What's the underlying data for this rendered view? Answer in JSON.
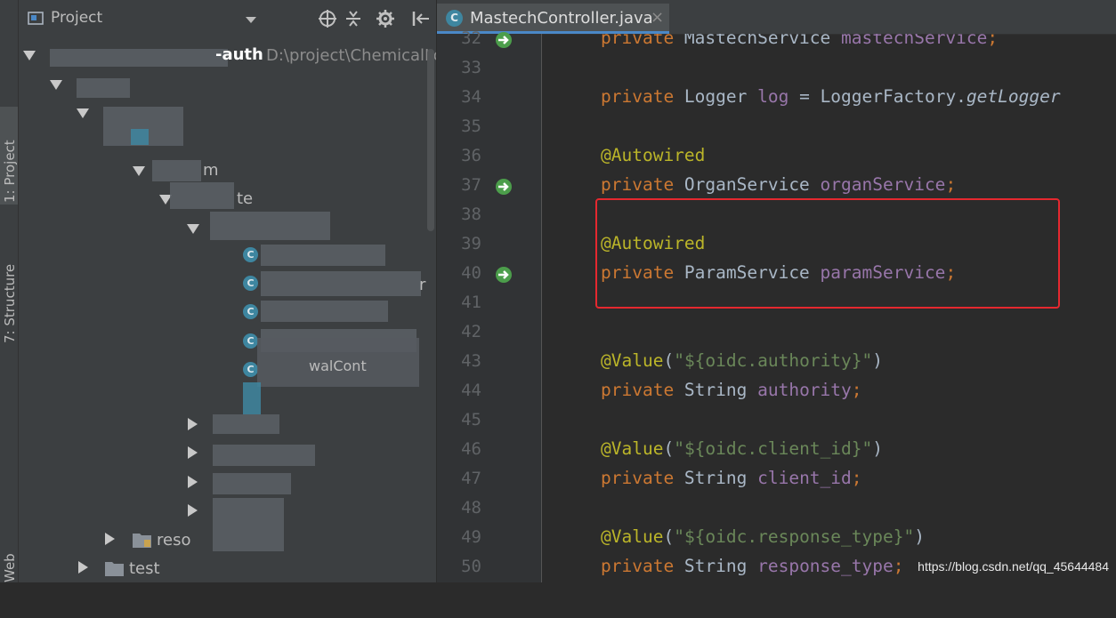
{
  "sidebar": {
    "tabs": [
      {
        "label": "1: Project"
      },
      {
        "label": "7: Structure"
      },
      {
        "label": "Web"
      }
    ]
  },
  "project_panel": {
    "title": "Project",
    "root_row": {
      "name_suffix": "-auth",
      "path": "D:\\project\\ChemicalLo"
    },
    "rows": [
      {
        "text": "m"
      },
      {
        "text": "te"
      },
      {
        "text": "r"
      },
      {
        "text": "walCont"
      },
      {
        "text": "reso"
      },
      {
        "text": "test"
      }
    ],
    "icons": [
      "target-icon",
      "collapse-icon",
      "gear-icon",
      "hide-icon"
    ]
  },
  "editor": {
    "tab": {
      "label": "MastechController.java",
      "icon_letter": "C",
      "close": "×"
    },
    "lines": [
      {
        "num": "32",
        "parts": [
          {
            "t": "private ",
            "c": "kw"
          },
          {
            "t": "MastechService ",
            "c": ""
          },
          {
            "t": "mastechService",
            "c": "fld"
          },
          {
            "t": ";",
            "c": "kw"
          }
        ]
      },
      {
        "num": "33",
        "parts": []
      },
      {
        "num": "34",
        "parts": [
          {
            "t": "private ",
            "c": "kw"
          },
          {
            "t": "Logger ",
            "c": ""
          },
          {
            "t": "log",
            "c": "fld"
          },
          {
            "t": " = LoggerFactory.",
            "c": ""
          },
          {
            "t": "getLogger",
            "c": "itl"
          }
        ]
      },
      {
        "num": "35",
        "parts": []
      },
      {
        "num": "36",
        "parts": [
          {
            "t": "@Autowired",
            "c": "ann"
          }
        ]
      },
      {
        "num": "37",
        "parts": [
          {
            "t": "private ",
            "c": "kw"
          },
          {
            "t": "OrganService ",
            "c": ""
          },
          {
            "t": "organService",
            "c": "fld"
          },
          {
            "t": ";",
            "c": "kw"
          }
        ]
      },
      {
        "num": "38",
        "parts": []
      },
      {
        "num": "39",
        "parts": [
          {
            "t": "@Autowired",
            "c": "ann"
          }
        ]
      },
      {
        "num": "40",
        "parts": [
          {
            "t": "private ",
            "c": "kw"
          },
          {
            "t": "ParamService ",
            "c": ""
          },
          {
            "t": "paramService",
            "c": "fld"
          },
          {
            "t": ";",
            "c": "kw"
          }
        ]
      },
      {
        "num": "41",
        "parts": []
      },
      {
        "num": "42",
        "parts": []
      },
      {
        "num": "43",
        "parts": [
          {
            "t": "@Value",
            "c": "ann"
          },
          {
            "t": "(",
            "c": ""
          },
          {
            "t": "\"${oidc.authority}\"",
            "c": "str"
          },
          {
            "t": ")",
            "c": ""
          }
        ]
      },
      {
        "num": "44",
        "parts": [
          {
            "t": "private ",
            "c": "kw"
          },
          {
            "t": "String ",
            "c": ""
          },
          {
            "t": "authority",
            "c": "fld"
          },
          {
            "t": ";",
            "c": "kw"
          }
        ]
      },
      {
        "num": "45",
        "parts": []
      },
      {
        "num": "46",
        "parts": [
          {
            "t": "@Value",
            "c": "ann"
          },
          {
            "t": "(",
            "c": ""
          },
          {
            "t": "\"${oidc.client_id}\"",
            "c": "str"
          },
          {
            "t": ")",
            "c": ""
          }
        ]
      },
      {
        "num": "47",
        "parts": [
          {
            "t": "private ",
            "c": "kw"
          },
          {
            "t": "String ",
            "c": ""
          },
          {
            "t": "client_id",
            "c": "fld"
          },
          {
            "t": ";",
            "c": "kw"
          }
        ]
      },
      {
        "num": "48",
        "parts": []
      },
      {
        "num": "49",
        "parts": [
          {
            "t": "@Value",
            "c": "ann"
          },
          {
            "t": "(",
            "c": ""
          },
          {
            "t": "\"${oidc.response_type}\"",
            "c": "str"
          },
          {
            "t": ")",
            "c": ""
          }
        ]
      },
      {
        "num": "50",
        "parts": [
          {
            "t": "private ",
            "c": "kw"
          },
          {
            "t": "String ",
            "c": ""
          },
          {
            "t": "response_type",
            "c": "fld"
          },
          {
            "t": ";",
            "c": "kw"
          }
        ]
      }
    ],
    "gutter_icon_lines": [
      "32",
      "37",
      "40"
    ]
  },
  "watermark": "https://blog.csdn.net/qq_45644484",
  "colors": {
    "highlight_box": "#e5282f",
    "tab_underline": "#4a88c7"
  }
}
